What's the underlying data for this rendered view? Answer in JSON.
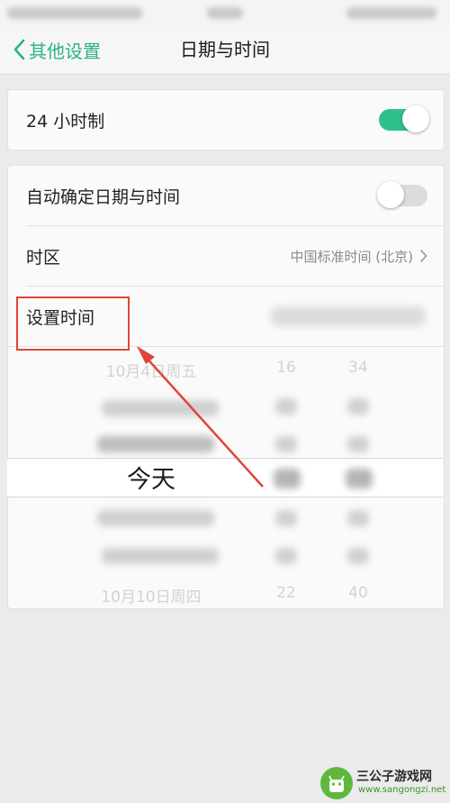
{
  "header": {
    "back_label": "其他设置",
    "title": "日期与时间"
  },
  "settings": {
    "hour24": {
      "label": "24 小时制",
      "enabled": true
    },
    "auto_time": {
      "label": "自动确定日期与时间",
      "enabled": false
    },
    "timezone": {
      "label": "时区",
      "value": "中国标准时间 (北京)"
    },
    "set_time": {
      "label": "设置时间"
    }
  },
  "picker": {
    "selected_date": "今天",
    "date_top": "10月4日周五",
    "date_bottom": "10月10日周四",
    "hour_top": "16",
    "hour_bottom": "22",
    "minute_top": "34",
    "minute_bottom": "40"
  },
  "watermark": {
    "title": "三公子游戏网",
    "url": "www.sangongzi.net"
  },
  "colors": {
    "accent": "#2fc08a",
    "highlight": "#e0453a"
  }
}
